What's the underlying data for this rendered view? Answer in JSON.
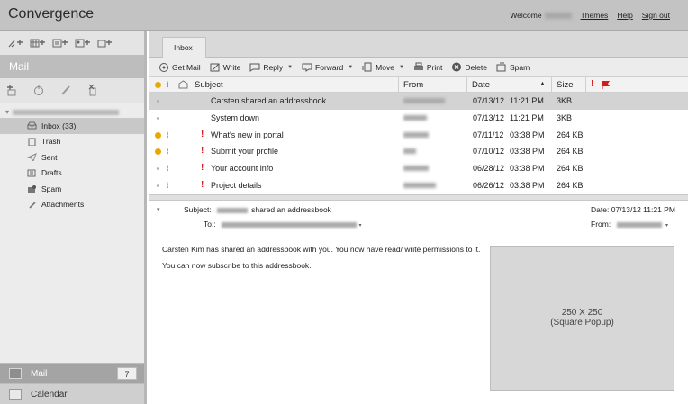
{
  "app_title": "Convergence",
  "top_links": {
    "welcome": "Welcome",
    "themes": "Themes",
    "help": "Help",
    "sign_out": "Sign out"
  },
  "sidebar": {
    "title": "Mail",
    "folders": [
      {
        "label": "Inbox (33)",
        "icon": "inbox-icon"
      },
      {
        "label": "Trash",
        "icon": "trash-icon"
      },
      {
        "label": "Sent",
        "icon": "sent-icon"
      },
      {
        "label": "Drafts",
        "icon": "drafts-icon"
      },
      {
        "label": "Spam",
        "icon": "spam-icon"
      },
      {
        "label": "Attachments",
        "icon": "attachment-icon"
      }
    ],
    "bottom": {
      "mail_label": "Mail",
      "mail_count": "7",
      "calendar_label": "Calendar"
    }
  },
  "tabs": [
    "Inbox"
  ],
  "toolbar": {
    "get_mail": "Get Mail",
    "write": "Write",
    "reply": "Reply",
    "forward": "Forward",
    "move": "Move",
    "print": "Print",
    "delete": "Delete",
    "spam": "Spam"
  },
  "columns": {
    "subject": "Subject",
    "from": "From",
    "date": "Date",
    "size": "Size"
  },
  "messages": [
    {
      "subject": "Carsten shared an addressbook",
      "date": "07/13/12",
      "time": "11:21  PM",
      "size": "3KB",
      "flag": "none",
      "attach": false,
      "important": false
    },
    {
      "subject": "System down",
      "date": "07/13/12",
      "time": "11:21  PM",
      "size": "3KB",
      "flag": "none",
      "attach": false,
      "important": false
    },
    {
      "subject": "What's new in portal",
      "date": "07/11/12",
      "time": "03:38  PM",
      "size": "264 KB",
      "flag": "orange",
      "attach": true,
      "important": true
    },
    {
      "subject": "Submit your profile",
      "date": "07/10/12",
      "time": "03:38  PM",
      "size": "264 KB",
      "flag": "orange",
      "attach": true,
      "important": true
    },
    {
      "subject": "Your account info",
      "date": "06/28/12",
      "time": "03:38  PM",
      "size": "264 KB",
      "flag": "none",
      "attach": true,
      "important": true
    },
    {
      "subject": "Project details",
      "date": "06/26/12",
      "time": "03:38  PM",
      "size": "264 KB",
      "flag": "none",
      "attach": true,
      "important": true
    }
  ],
  "preview": {
    "subject_label": "Subject:",
    "subject_text": "shared an addressbook",
    "to_label": "To::",
    "date_label": "Date:",
    "date_value": "07/13/12   11:21  PM",
    "from_label": "From:",
    "body_line1": "Carsten Kim has shared an addressbook with you. You now have read/ write permissions to it.",
    "body_line2": "You can now subscribe to this addressbook.",
    "ad_line1": "250 X 250",
    "ad_line2": "(Square Popup)"
  },
  "colors": {
    "accent_dot": "#e8a800",
    "flag_red": "#d21c1c"
  }
}
